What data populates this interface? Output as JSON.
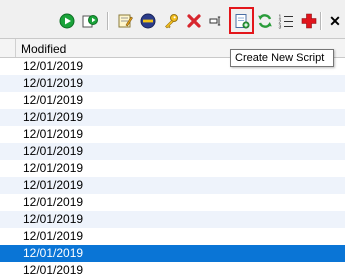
{
  "toolbar": {
    "tooltip": "Create New Script",
    "close_glyph": "✕"
  },
  "table": {
    "column_header": "Modified",
    "rows": [
      {
        "modified": "12/01/2019"
      },
      {
        "modified": "12/01/2019"
      },
      {
        "modified": "12/01/2019"
      },
      {
        "modified": "12/01/2019"
      },
      {
        "modified": "12/01/2019"
      },
      {
        "modified": "12/01/2019"
      },
      {
        "modified": "12/01/2019"
      },
      {
        "modified": "12/01/2019"
      },
      {
        "modified": "12/01/2019"
      },
      {
        "modified": "12/01/2019"
      },
      {
        "modified": "12/01/2019"
      },
      {
        "modified": "12/01/2019"
      },
      {
        "modified": "12/01/2019"
      }
    ],
    "selected_row": 11
  },
  "colors": {
    "selection": "#0a75d6",
    "alt_row": "#eef3fb",
    "highlight_box": "#e3161b"
  }
}
